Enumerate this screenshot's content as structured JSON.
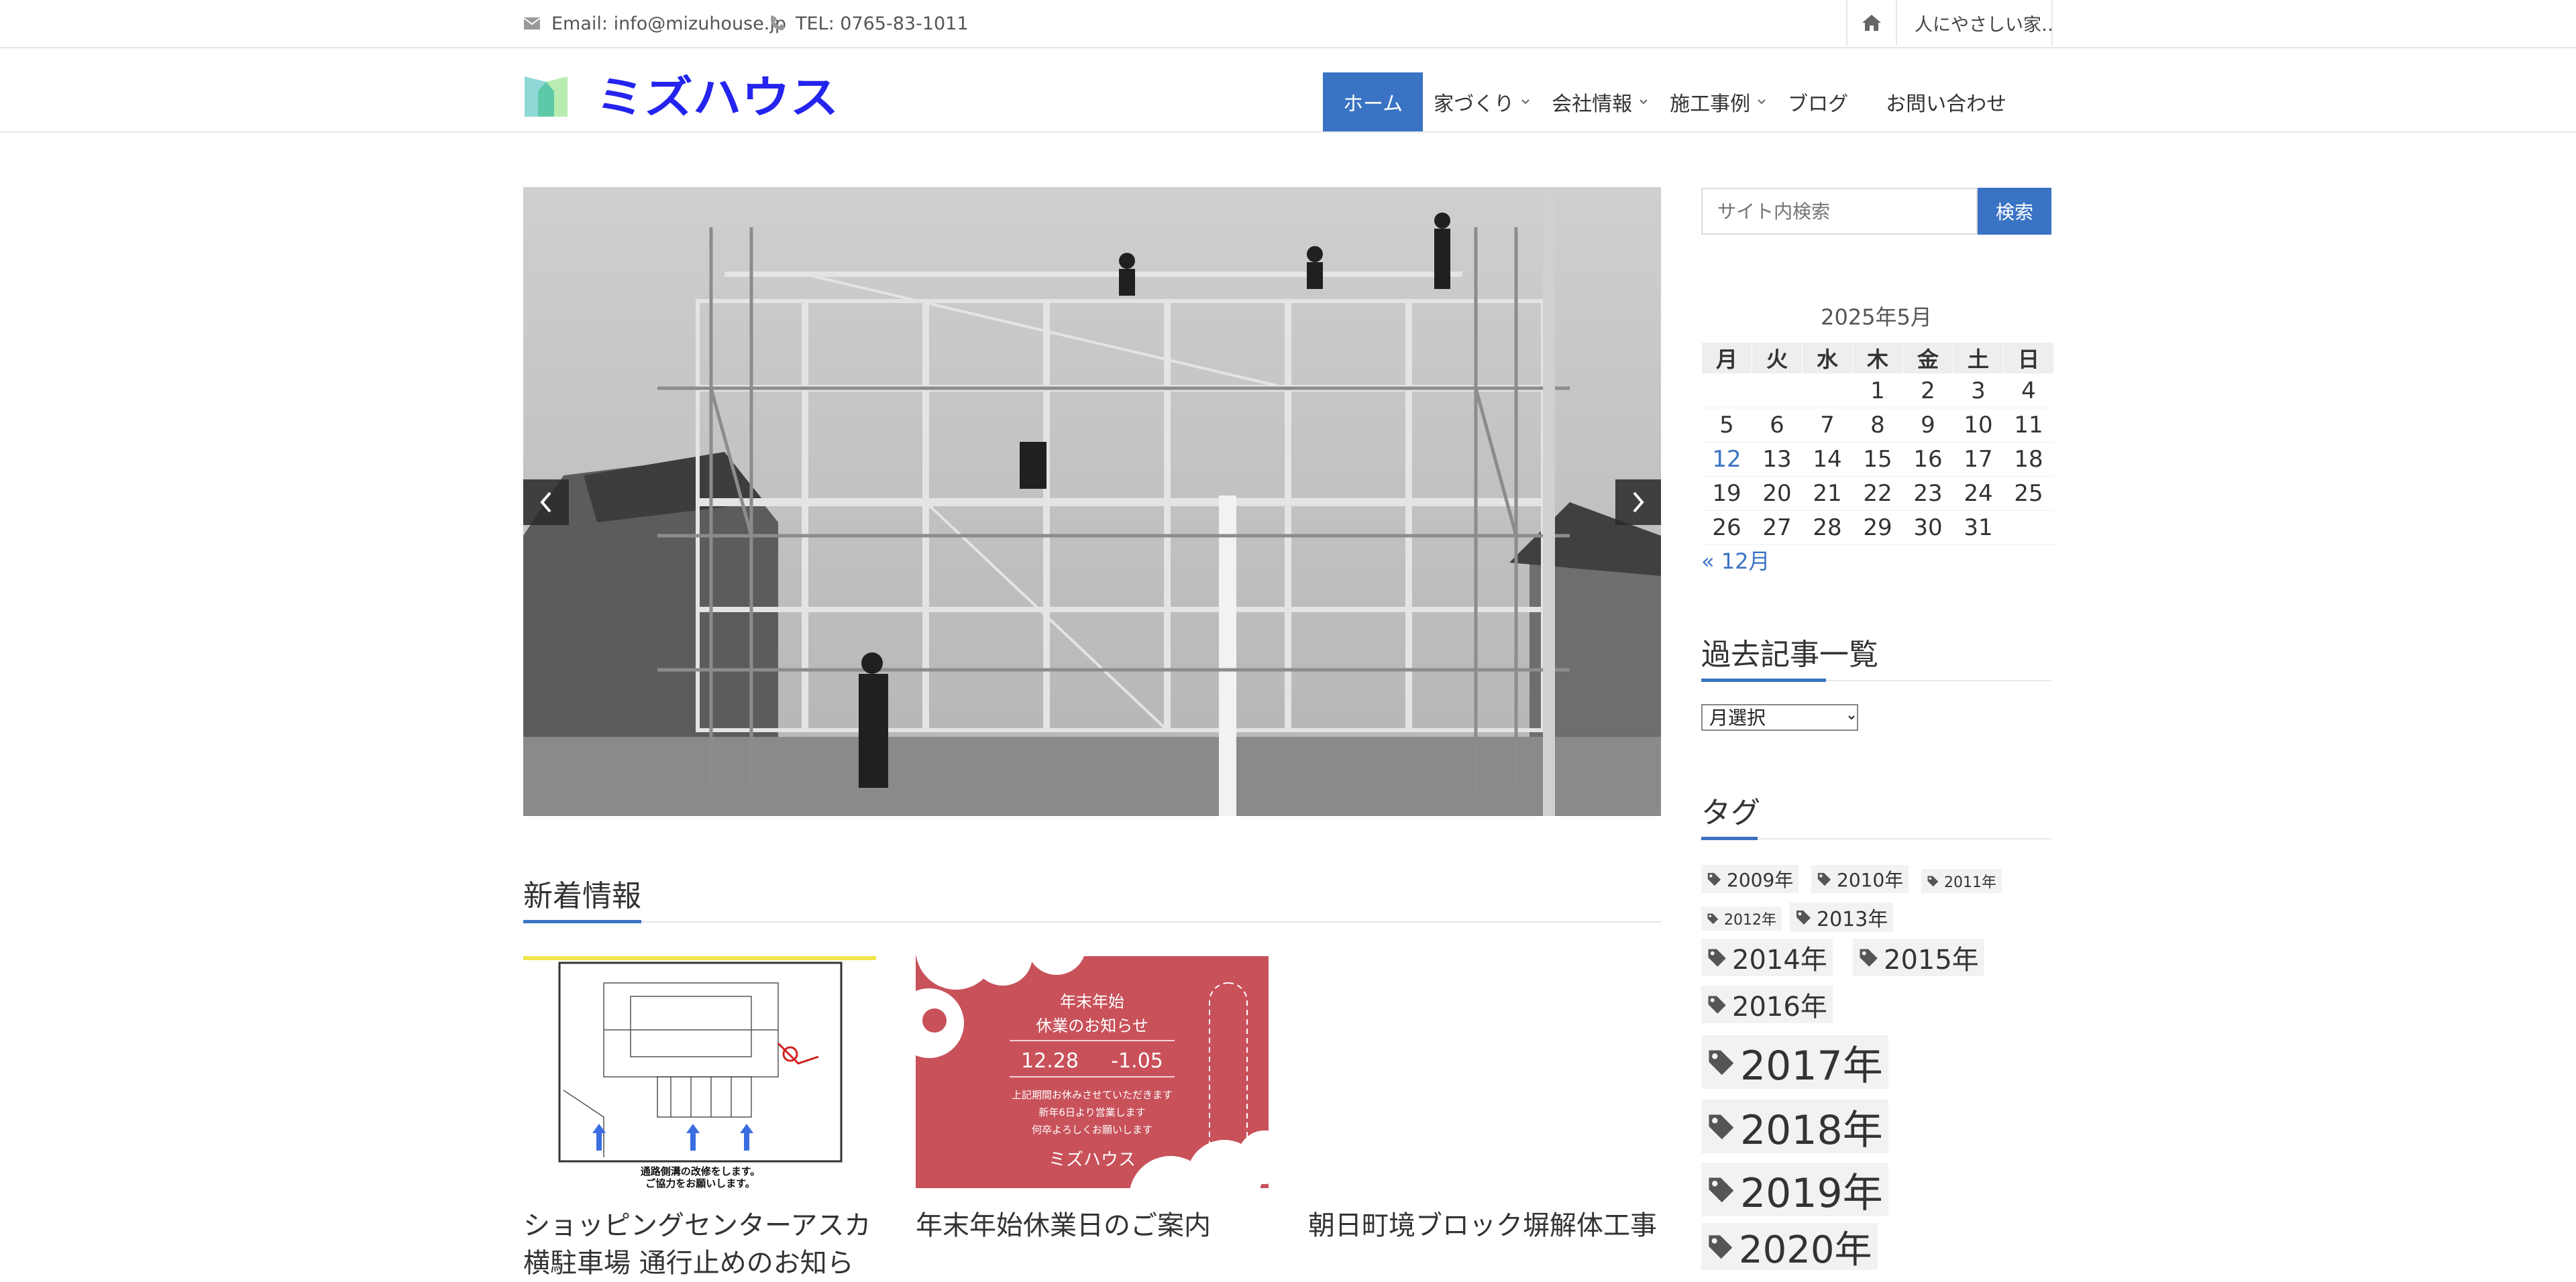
{
  "topbar": {
    "email_icon": "envelope-icon",
    "email": "Email: info@mizuhouse.jp",
    "phone_icon": "phone-icon",
    "phone": "TEL: 0765-83-1011",
    "home_icon": "home-icon",
    "tagline": "人にやさしい家…"
  },
  "header": {
    "logo_text": "ミズハウス",
    "logo_colors": {
      "mark_left": "#8fd8d8",
      "mark_right": "#b8ecb0",
      "text": "#2424ee"
    },
    "nav": [
      {
        "label": "ホーム",
        "active": true,
        "dropdown": false
      },
      {
        "label": "家づくり",
        "active": false,
        "dropdown": true
      },
      {
        "label": "会社情報",
        "active": false,
        "dropdown": true
      },
      {
        "label": "施工事例",
        "active": false,
        "dropdown": true
      },
      {
        "label": "ブログ",
        "active": false,
        "dropdown": false
      },
      {
        "label": "お問い合わせ",
        "active": false,
        "dropdown": false
      }
    ],
    "accent_color": "#3a73c4"
  },
  "slider": {
    "prev_icon": "chevron-left-icon",
    "next_icon": "chevron-right-icon",
    "image_icon": "house-frame-construction-photo"
  },
  "news": {
    "title": "新着情報",
    "cards": [
      {
        "title_line1": "ショッピングセンターアスカ",
        "title_line2": "横駐車場 通行止めのお知ら",
        "image_caption_line1": "通路側溝の改修をします。",
        "image_caption_line2": "ご協力をお願いします。"
      },
      {
        "title_line1": "年末年始休業日のご案内",
        "image_line1": "年末年始",
        "image_line2": "休業のお知らせ",
        "image_line3": "12.28",
        "image_line3b": "-1.05",
        "image_line4": "上記期間お休みさせていただきます",
        "image_line5": "新年6日より営業します",
        "image_line6": "何卒よろしくお願いします",
        "image_line7": "ミズハウス",
        "image_bg": "#c8515a"
      },
      {
        "title_line1": "朝日町境ブロック塀解体工事"
      }
    ]
  },
  "sidebar": {
    "search": {
      "placeholder": "サイト内検索",
      "button": "検索"
    },
    "calendar": {
      "caption": "2025年5月",
      "headers": [
        "月",
        "火",
        "水",
        "木",
        "金",
        "土",
        "日"
      ],
      "rows": [
        [
          "",
          "",
          "",
          "1",
          "2",
          "3",
          "4"
        ],
        [
          "5",
          "6",
          "7",
          "8",
          "9",
          "10",
          "11"
        ],
        [
          "12",
          "13",
          "14",
          "15",
          "16",
          "17",
          "18"
        ],
        [
          "19",
          "20",
          "21",
          "22",
          "23",
          "24",
          "25"
        ],
        [
          "26",
          "27",
          "28",
          "29",
          "30",
          "31",
          ""
        ]
      ],
      "linked_day": "12",
      "prev_link": "« 12月"
    },
    "archive": {
      "title": "過去記事一覧",
      "select_label": "月選択"
    },
    "tags": {
      "title": "タグ",
      "tag_icon": "tag-icon",
      "items": [
        "2009年",
        "2010年",
        "2011年",
        "2012年",
        "2013年",
        "2014年",
        "2015年",
        "2016年",
        "2017年",
        "2018年",
        "2019年",
        "2020年"
      ]
    }
  }
}
